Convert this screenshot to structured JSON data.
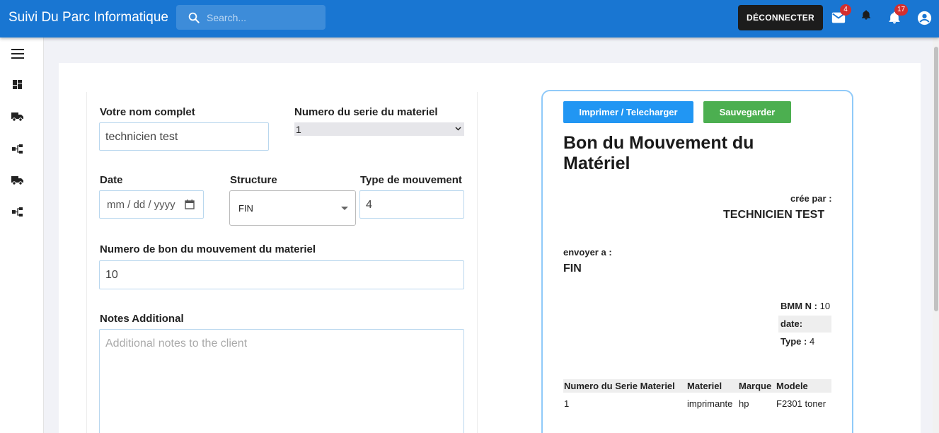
{
  "header": {
    "title": "Suivi Du Parc Informatique",
    "search_placeholder": "Search...",
    "logout_label": "DÉCONNECTER",
    "mail_badge": "4",
    "notifications_badge": "17"
  },
  "sidebar": {
    "items": [
      {
        "icon": "menu-icon"
      },
      {
        "icon": "dashboard-icon"
      },
      {
        "icon": "truck-icon"
      },
      {
        "icon": "hierarchy-icon"
      },
      {
        "icon": "truck-icon"
      },
      {
        "icon": "hierarchy-icon"
      }
    ]
  },
  "form": {
    "name_label": "Votre nom complet",
    "name_value": "technicien test",
    "serial_label": "Numero du serie du materiel",
    "serial_value": "1",
    "date_label": "Date",
    "date_placeholder": "mm / dd / yyyy",
    "structure_label": "Structure",
    "structure_value": "FIN",
    "type_label": "Type de mouvement",
    "type_value": "4",
    "bon_label": "Numero de bon du mouvement du materiel",
    "bon_value": "10",
    "notes_label": "Notes Additional",
    "notes_placeholder": "Additional notes to the client"
  },
  "preview": {
    "print_label": "Imprimer / Telecharger",
    "save_label": "Sauvegarder",
    "title": "Bon du Mouvement du Matériel",
    "created_by_label": "crée par :",
    "created_by_value": "TECHNICIEN TEST",
    "send_to_label": "envoyer a :",
    "send_to_value": "FIN",
    "bmm_label": "BMM N :",
    "bmm_value": "10",
    "date_label": "date:",
    "date_value": "",
    "type_label": "Type :",
    "type_value": "4",
    "table": {
      "headers": [
        "Numero du Serie Materiel",
        "Materiel",
        "Marque",
        "Modele"
      ],
      "rows": [
        [
          "1",
          "imprimante",
          "hp",
          "F2301 toner"
        ]
      ]
    }
  },
  "colors": {
    "topbar": "#1976d2",
    "print_button": "#2196f3",
    "save_button": "#4caf50",
    "badge": "#d32f2f",
    "preview_border": "#90caf9"
  }
}
